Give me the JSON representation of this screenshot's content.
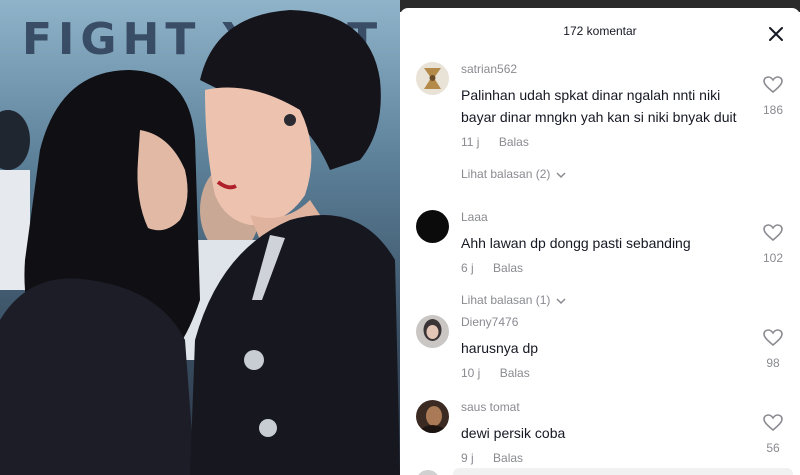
{
  "photo": {
    "banner_text": "FIGHT Y    NIT"
  },
  "panel": {
    "title": "172 komentar",
    "close_icon": "close-icon"
  },
  "comments": [
    {
      "username": "satrian562",
      "text": "Palinhan udah spkat dinar ngalah nnti niki bayar dinar mngkn yah kan si niki bnyak duit",
      "time": "11 j",
      "reply_label": "Balas",
      "likes": "186",
      "view_replies": "Lihat balasan (2)"
    },
    {
      "username": "Laaa",
      "text": "Ahh lawan dp dongg pasti sebanding",
      "time": "6 j",
      "reply_label": "Balas",
      "likes": "102",
      "view_replies": "Lihat balasan (1)"
    },
    {
      "username": "Dieny7476",
      "text": "harusnya dp",
      "time": "10 j",
      "reply_label": "Balas",
      "likes": "98"
    },
    {
      "username": "saus tomat",
      "text": "dewi persik coba",
      "time": "9 j",
      "reply_label": "Balas",
      "likes": "56"
    }
  ],
  "colors": {
    "text_primary": "#161823",
    "text_secondary": "#8a8b91"
  }
}
